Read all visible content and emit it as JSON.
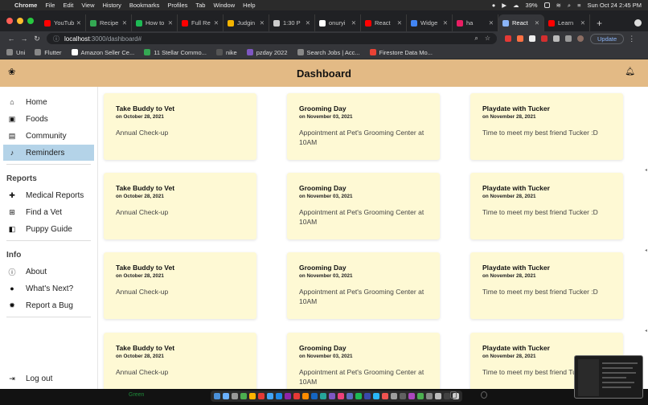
{
  "menubar": {
    "app_name": "Chrome",
    "items": [
      "File",
      "Edit",
      "View",
      "History",
      "Bookmarks",
      "Profiles",
      "Tab",
      "Window",
      "Help"
    ],
    "battery": "39%",
    "clock": "Sun Oct 24  2:45 PM"
  },
  "tabs": [
    {
      "label": "YouTub",
      "color": "#ff0000"
    },
    {
      "label": "Recipe",
      "color": "#34a853"
    },
    {
      "label": "How to",
      "color": "#1db954"
    },
    {
      "label": "Full Re",
      "color": "#ff0000"
    },
    {
      "label": "Judgin",
      "color": "#f4b400"
    },
    {
      "label": "1:30 P",
      "color": "#cccccc"
    },
    {
      "label": "onuryi",
      "color": "#ffffff"
    },
    {
      "label": "React",
      "color": "#ff0000"
    },
    {
      "label": "Widge",
      "color": "#4285f4"
    },
    {
      "label": "ha",
      "color": "#e91e63"
    },
    {
      "label": "React",
      "color": "#8ab4f8",
      "active": true
    },
    {
      "label": "Learn",
      "color": "#ff0000"
    }
  ],
  "address": {
    "host": "localhost",
    "path": ":3000/dashboard#",
    "update_label": "Update"
  },
  "bookmarks": [
    {
      "label": "Uni",
      "color": "#888888"
    },
    {
      "label": "Flutter",
      "color": "#888888"
    },
    {
      "label": "Amazon Seller Ce...",
      "color": "#ffffff"
    },
    {
      "label": "11 Stellar Commo...",
      "color": "#34a853"
    },
    {
      "label": "nike",
      "color": "#555555"
    },
    {
      "label": "pzday 2022",
      "color": "#7e57c2"
    },
    {
      "label": "Search Jobs | Acc...",
      "color": "#888888"
    },
    {
      "label": "Firestore Data Mo...",
      "color": "#ea4335"
    }
  ],
  "header": {
    "title": "Dashboard"
  },
  "sidebar": {
    "main_items": [
      {
        "label": "Home",
        "icon": "⌂",
        "name": "home"
      },
      {
        "label": "Foods",
        "icon": "▣",
        "name": "foods"
      },
      {
        "label": "Community",
        "icon": "▤",
        "name": "community"
      },
      {
        "label": "Reminders",
        "icon": "♪",
        "name": "reminders",
        "active": true
      }
    ],
    "reports_title": "Reports",
    "reports_items": [
      {
        "label": "Medical Reports",
        "icon": "✚",
        "name": "medical-reports"
      },
      {
        "label": "Find a Vet",
        "icon": "⊞",
        "name": "find-a-vet"
      },
      {
        "label": "Puppy Guide",
        "icon": "◧",
        "name": "puppy-guide"
      }
    ],
    "info_title": "Info",
    "info_items": [
      {
        "label": "About",
        "icon": "ⓘ",
        "name": "about"
      },
      {
        "label": "What's Next?",
        "icon": "●",
        "name": "whats-next"
      },
      {
        "label": "Report a Bug",
        "icon": "✹",
        "name": "report-a-bug"
      }
    ],
    "logout_label": "Log out"
  },
  "reminders": [
    {
      "title": "Take Buddy to Vet",
      "date": "on October 28, 2021",
      "desc": "Annual Check-up"
    },
    {
      "title": "Grooming Day",
      "date": "on November 03, 2021",
      "desc": "Appointment at Pet's Grooming Center at 10AM"
    },
    {
      "title": "Playdate with Tucker",
      "date": "on November 28, 2021",
      "desc": "Time to meet my best friend Tucker :D"
    },
    {
      "title": "Take Buddy to Vet",
      "date": "on October 28, 2021",
      "desc": "Annual Check-up"
    },
    {
      "title": "Grooming Day",
      "date": "on November 03, 2021",
      "desc": "Appointment at Pet's Grooming Center at 10AM"
    },
    {
      "title": "Playdate with Tucker",
      "date": "on November 28, 2021",
      "desc": "Time to meet my best friend Tucker :D"
    },
    {
      "title": "Take Buddy to Vet",
      "date": "on October 28, 2021",
      "desc": "Annual Check-up"
    },
    {
      "title": "Grooming Day",
      "date": "on November 03, 2021",
      "desc": "Appointment at Pet's Grooming Center at 10AM"
    },
    {
      "title": "Playdate with Tucker",
      "date": "on November 28, 2021",
      "desc": "Time to meet my best friend Tucker :D"
    },
    {
      "title": "Take Buddy to Vet",
      "date": "on October 28, 2021",
      "desc": "Annual Check-up"
    },
    {
      "title": "Grooming Day",
      "date": "on November 03, 2021",
      "desc": "Appointment at Pet's Grooming Center at 10AM"
    },
    {
      "title": "Playdate with Tucker",
      "date": "on November 28, 2021",
      "desc": "Time to meet my best friend Tucker :D"
    }
  ],
  "dock": {
    "green_label": "Green"
  },
  "colors": {
    "header_bg": "#e3ba85",
    "card_bg": "#fef9d4",
    "active_item": "#b4d3e8"
  }
}
